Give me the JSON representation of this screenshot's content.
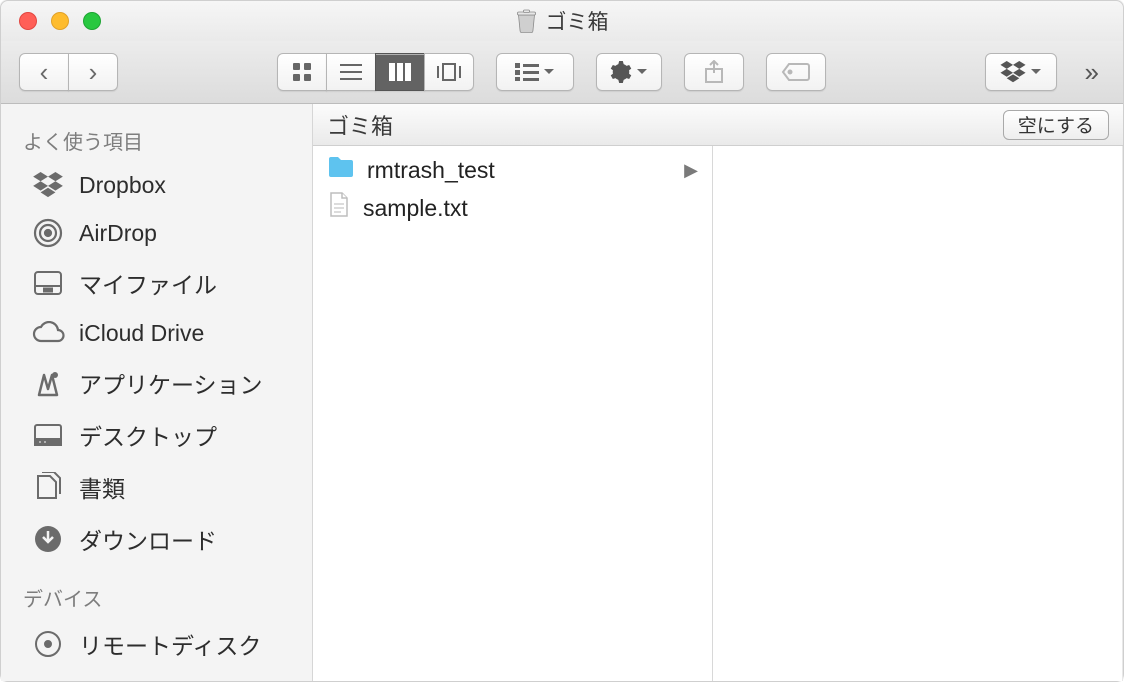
{
  "title": "ゴミ箱",
  "sidebar": {
    "section_favorites": "よく使う項目",
    "section_devices": "デバイス",
    "items": [
      {
        "icon": "dropbox-icon",
        "label": "Dropbox"
      },
      {
        "icon": "airdrop-icon",
        "label": "AirDrop"
      },
      {
        "icon": "all-my-files-icon",
        "label": "マイファイル"
      },
      {
        "icon": "icloud-drive-icon",
        "label": "iCloud Drive"
      },
      {
        "icon": "applications-icon",
        "label": "アプリケーション"
      },
      {
        "icon": "desktop-icon",
        "label": "デスクトップ"
      },
      {
        "icon": "documents-icon",
        "label": "書類"
      },
      {
        "icon": "downloads-icon",
        "label": "ダウンロード"
      }
    ],
    "devices": [
      {
        "icon": "remote-disc-icon",
        "label": "リモートディスク"
      }
    ]
  },
  "toolbar": {
    "empty_label": "空にする"
  },
  "path_bar": {
    "title": "ゴミ箱"
  },
  "column_items": [
    {
      "name": "rmtrash_test",
      "kind": "folder",
      "has_children": true
    },
    {
      "name": "sample.txt",
      "kind": "document",
      "has_children": false
    }
  ]
}
